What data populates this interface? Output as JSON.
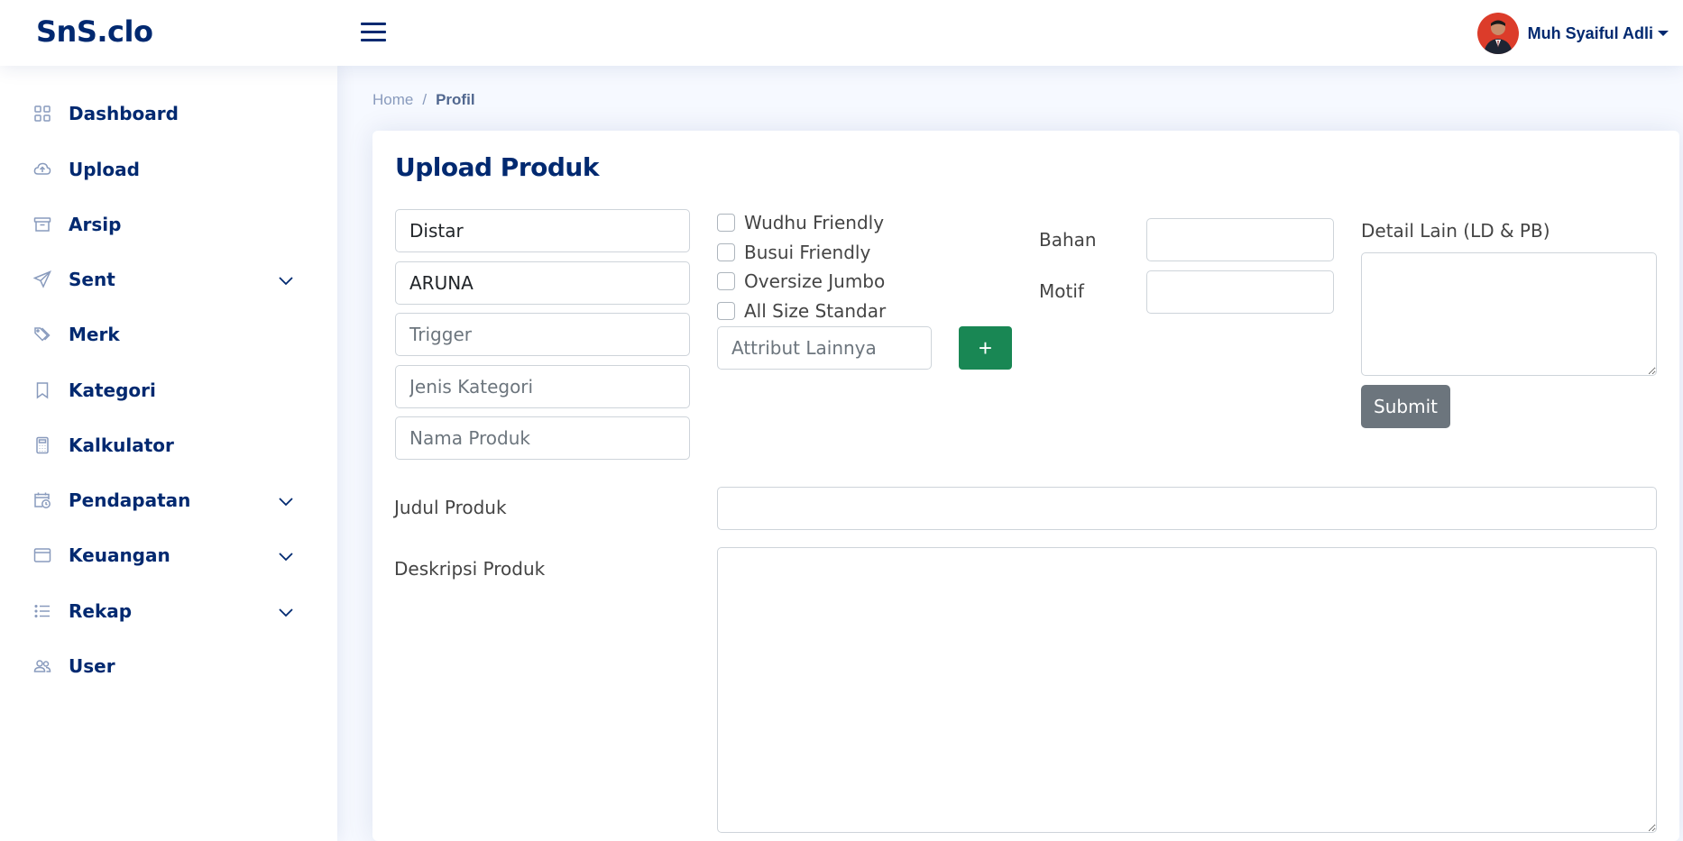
{
  "header": {
    "logo": "SnS.clo",
    "user_name": "Muh Syaiful Adli"
  },
  "sidebar": {
    "items": [
      {
        "label": "Dashboard",
        "icon": "grid-icon"
      },
      {
        "label": "Upload",
        "icon": "cloud-upload-icon"
      },
      {
        "label": "Arsip",
        "icon": "archive-icon"
      },
      {
        "label": "Sent",
        "icon": "send-icon",
        "expandable": true
      },
      {
        "label": "Merk",
        "icon": "tags-icon"
      },
      {
        "label": "Kategori",
        "icon": "bookmark-icon"
      },
      {
        "label": "Kalkulator",
        "icon": "calculator-icon"
      },
      {
        "label": "Pendapatan",
        "icon": "calendar-clock-icon",
        "expandable": true
      },
      {
        "label": "Keuangan",
        "icon": "window-icon",
        "expandable": true
      },
      {
        "label": "Rekap",
        "icon": "list-icon",
        "expandable": true
      },
      {
        "label": "User",
        "icon": "people-icon"
      }
    ]
  },
  "breadcrumb": {
    "home": "Home",
    "separator": "/",
    "current": "Profil"
  },
  "form": {
    "title": "Upload Produk",
    "merk_value": "Distar",
    "brand_value": "ARUNA",
    "trigger_placeholder": "Trigger",
    "jenis_kategori_placeholder": "Jenis Kategori",
    "nama_produk_placeholder": "Nama Produk",
    "checkboxes": [
      "Wudhu Friendly",
      "Busui Friendly",
      "Oversize Jumbo",
      "All Size Standar"
    ],
    "attribut_placeholder": "Attribut Lainnya",
    "add_button": "+",
    "bahan_label": "Bahan",
    "motif_label": "Motif",
    "detail_lain_label": "Detail Lain (LD & PB)",
    "submit_label": "Submit",
    "judul_label": "Judul Produk",
    "deskripsi_label": "Deskripsi Produk"
  },
  "colors": {
    "brand": "#012970",
    "accent_green": "#198754",
    "submit_gray": "#6c757d",
    "background": "#f6f9ff"
  }
}
